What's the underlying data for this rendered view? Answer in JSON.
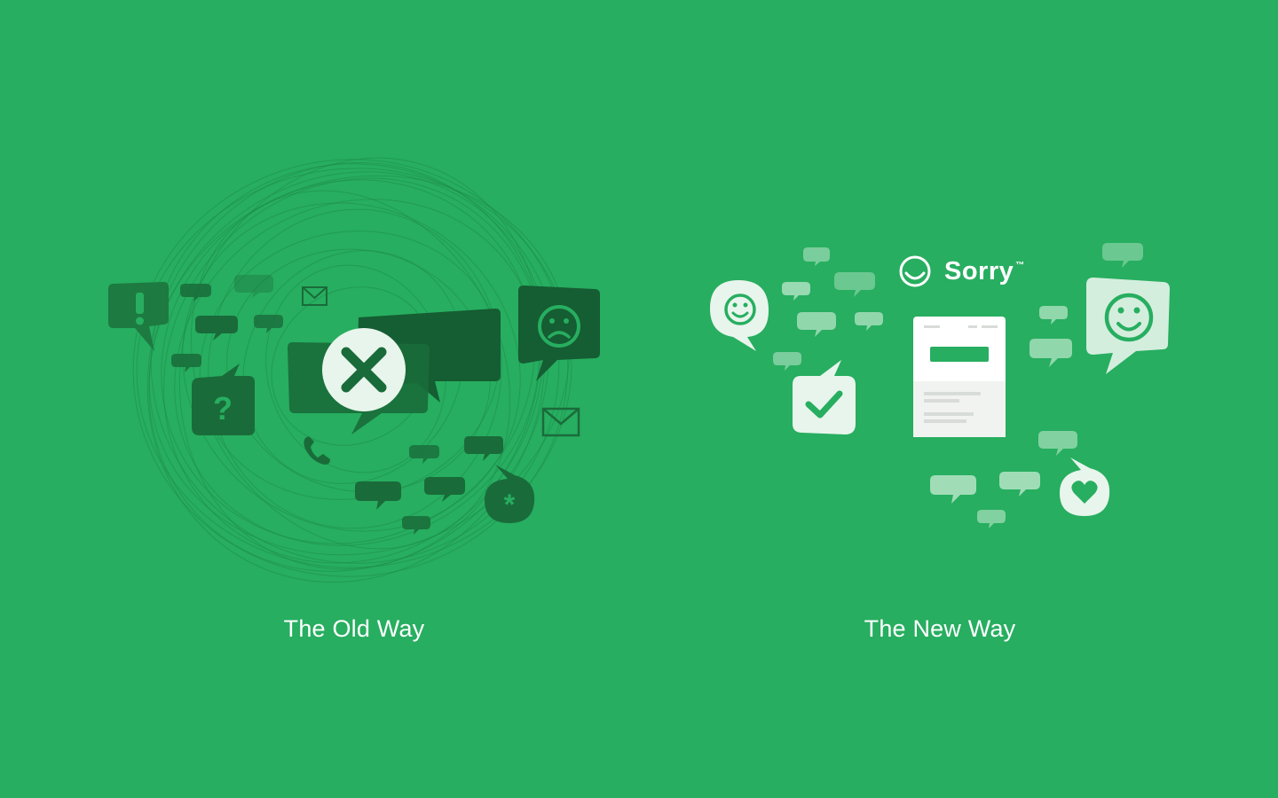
{
  "panels": {
    "old": {
      "caption": "The Old Way"
    },
    "new": {
      "caption": "The New Way"
    }
  },
  "brand": {
    "name": "Sorry",
    "tm": "™"
  },
  "colors": {
    "background": "#27ae60",
    "old_dark": "#1a6b3a",
    "new_light": "#e8f5ec",
    "new_mid": "#8fd4a8"
  },
  "icons": {
    "old": [
      "exclamation-bubble-icon",
      "question-bubble-icon",
      "sad-face-bubble-icon",
      "envelope-icon",
      "phone-icon",
      "asterisk-bubble-icon",
      "x-mark-icon"
    ],
    "new": [
      "smile-bubble-icon",
      "check-bubble-icon",
      "heart-bubble-icon",
      "status-page-icon",
      "sorry-logo-icon"
    ]
  }
}
